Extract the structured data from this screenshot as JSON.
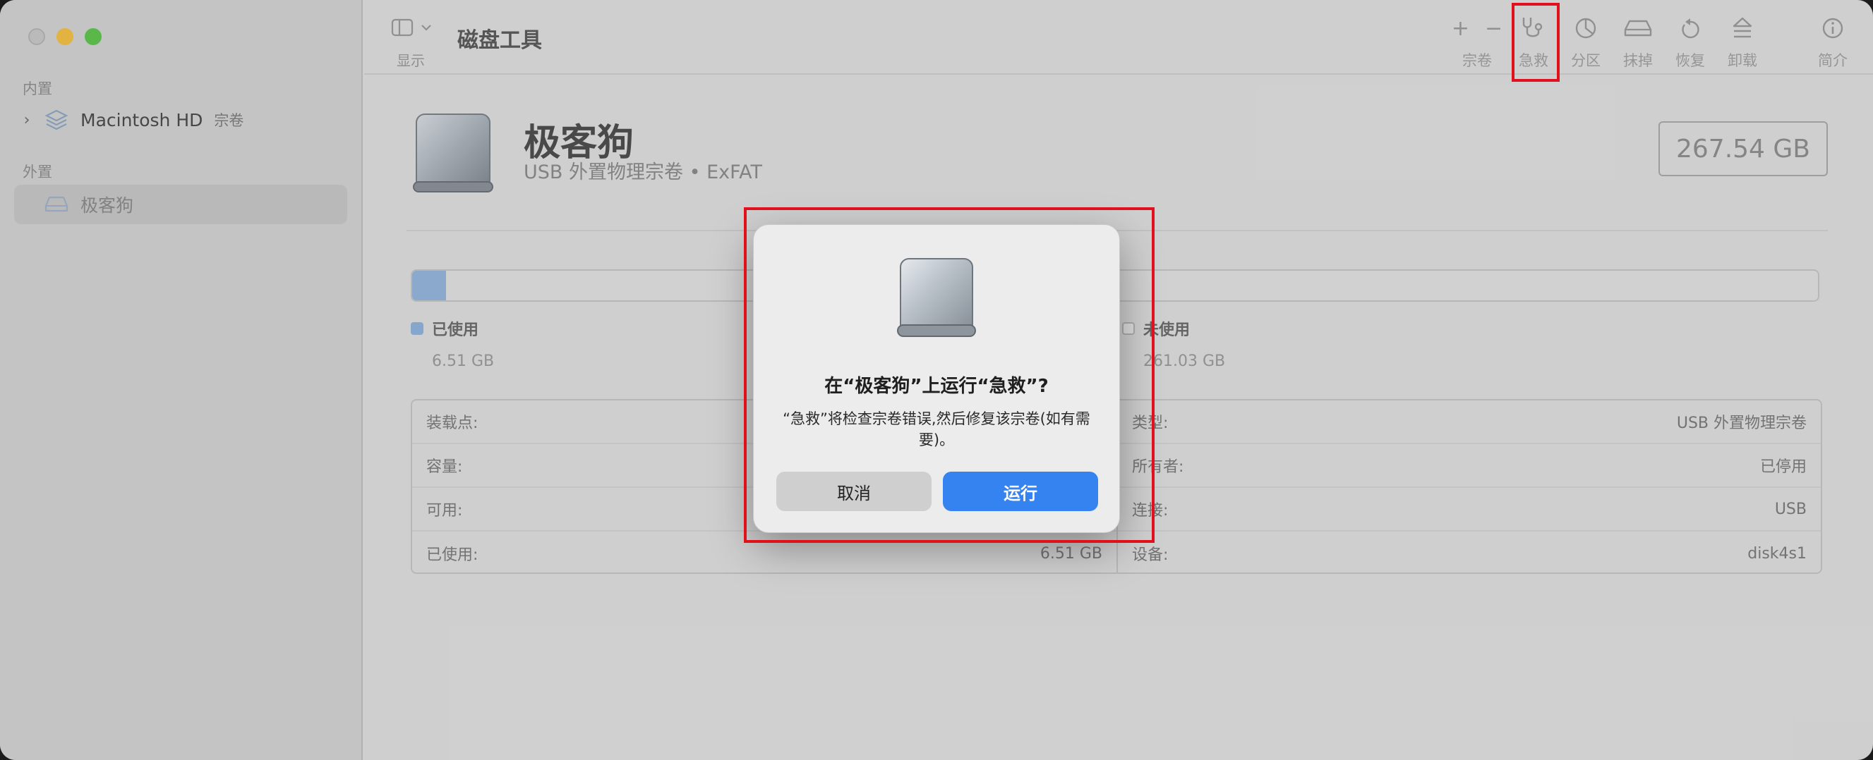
{
  "sidebar": {
    "internal_header": "内置",
    "external_header": "外置",
    "items": [
      {
        "label": "Macintosh HD",
        "sub": "宗卷"
      },
      {
        "label": "极客狗"
      }
    ]
  },
  "toolbar": {
    "show_label": "显示",
    "title": "磁盘工具",
    "buttons": [
      {
        "label": "宗卷",
        "icon": "plus-minus-icon"
      },
      {
        "label": "急救",
        "icon": "stethoscope-icon"
      },
      {
        "label": "分区",
        "icon": "pie-chart-icon"
      },
      {
        "label": "抹掉",
        "icon": "erase-icon"
      },
      {
        "label": "恢复",
        "icon": "restore-icon"
      },
      {
        "label": "卸载",
        "icon": "eject-icon"
      },
      {
        "label": "简介",
        "icon": "info-icon"
      }
    ]
  },
  "disk": {
    "name": "极客狗",
    "description": "USB 外置物理宗卷 • ExFAT",
    "capacity": "267.54 GB",
    "used_fraction": 0.024
  },
  "legend": {
    "used_label": "已使用",
    "used_value": "6.51 GB",
    "free_label": "未使用",
    "free_value": "261.03 GB"
  },
  "info": {
    "left": [
      {
        "label": "装载点:",
        "value": ""
      },
      {
        "label": "容量:",
        "value": ""
      },
      {
        "label": "可用:",
        "value": ""
      },
      {
        "label": "已使用:",
        "value": "6.51 GB"
      }
    ],
    "right": [
      {
        "label": "类型:",
        "value": "USB 外置物理宗卷"
      },
      {
        "label": "所有者:",
        "value": "已停用"
      },
      {
        "label": "连接:",
        "value": "USB"
      },
      {
        "label": "设备:",
        "value": "disk4s1"
      }
    ]
  },
  "dialog": {
    "title": "在“极客狗”上运行“急救”?",
    "message": "“急救”将检查宗卷错误,然后修复该宗卷(如有需要)。",
    "cancel_label": "取消",
    "run_label": "运行"
  },
  "colors": {
    "accent": "#3582f1",
    "highlight": "#e0101e",
    "used": "#93b5dc"
  }
}
